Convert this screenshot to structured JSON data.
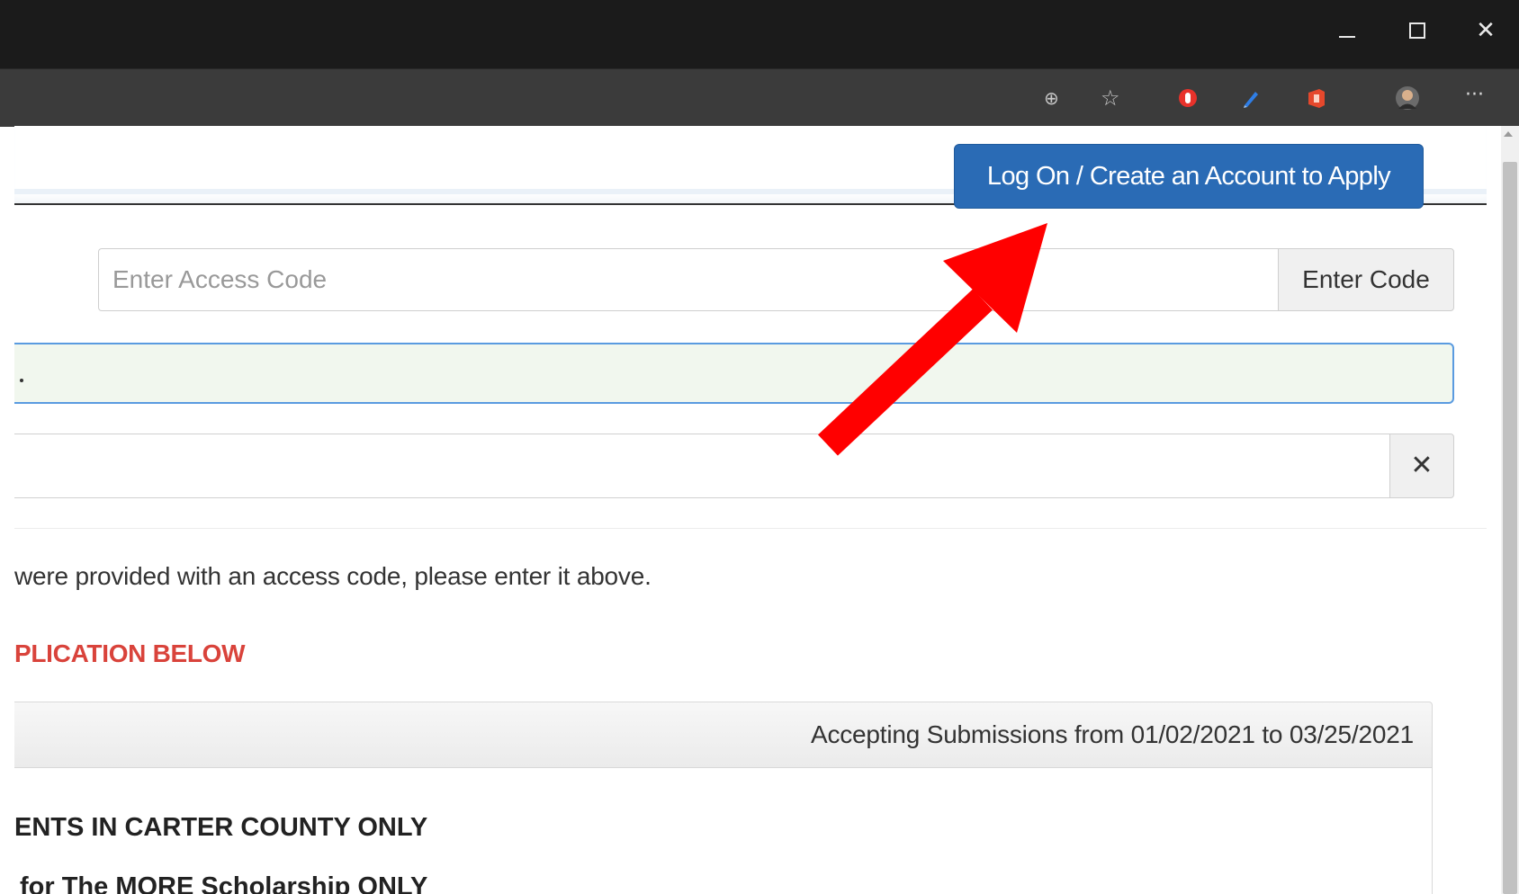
{
  "window": {
    "minimize_icon": "minimize-icon",
    "maximize_icon": "maximize-icon",
    "close_glyph": "✕"
  },
  "toolbar": {
    "zoom_glyph": "⊕",
    "favorite_glyph": "☆",
    "more_glyph": "···"
  },
  "header": {
    "logon_button": "Log On / Create an Account to Apply",
    "button_color": "#2a6bb5"
  },
  "access": {
    "placeholder": "Enter Access Code",
    "button_label": "Enter Code"
  },
  "info_field": {
    "text": "."
  },
  "clear_button": {
    "glyph": "✕"
  },
  "content": {
    "info_text": "were provided with an access code, please enter it above.",
    "red_heading": "PLICATION BELOW",
    "red_color": "#d9433b",
    "submissions": "Accepting Submissions from 01/02/2021 to 03/25/2021",
    "heading_county": "ENTS IN CARTER COUNTY ONLY",
    "heading_more": "for The MORE Scholarship ONLY"
  },
  "annotation": {
    "arrow_color": "#ff0000"
  }
}
